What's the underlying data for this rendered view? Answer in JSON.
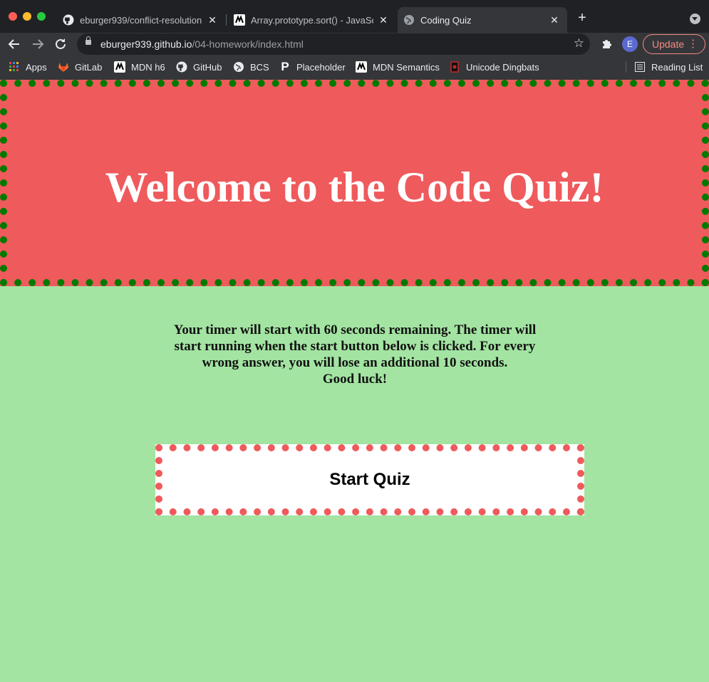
{
  "browser": {
    "tabs": [
      {
        "title": "eburger939/conflict-resolution",
        "favicon": "github-icon",
        "active": false
      },
      {
        "title": "Array.prototype.sort() - JavaScript",
        "favicon": "mdn-icon",
        "active": false
      },
      {
        "title": "Coding Quiz",
        "favicon": "globe-icon",
        "active": true
      }
    ],
    "close_glyph": "✕",
    "new_tab_glyph": "+",
    "url": {
      "host": "eburger939.github.io",
      "path": "/04-homework/index.html"
    },
    "profile_initial": "E",
    "update_label": "Update",
    "bookmarks": [
      {
        "label": "Apps",
        "icon": "apps-grid-icon"
      },
      {
        "label": "GitLab",
        "icon": "gitlab-icon"
      },
      {
        "label": "MDN h6",
        "icon": "mdn-icon"
      },
      {
        "label": "GitHub",
        "icon": "github-icon"
      },
      {
        "label": "BCS",
        "icon": "globe-icon"
      },
      {
        "label": "Placeholder",
        "icon": "placeholder-p-icon"
      },
      {
        "label": "MDN Semantics",
        "icon": "mdn-icon"
      },
      {
        "label": "Unicode Dingbats",
        "icon": "dingbats-icon"
      }
    ],
    "reading_list_label": "Reading List"
  },
  "page": {
    "heading": "Welcome to the Code Quiz!",
    "instructions": [
      "Your timer will start with 60 seconds remaining. The timer will",
      "start running when the start button below is clicked. For every",
      "wrong answer, you will lose an additional 10 seconds.",
      "Good luck!"
    ],
    "start_button": "Start Quiz"
  },
  "colors": {
    "header_bg": "#ef5a5c",
    "header_border": "#007a00",
    "page_bg": "#a3e4a2",
    "button_border": "#ef5a5c"
  }
}
